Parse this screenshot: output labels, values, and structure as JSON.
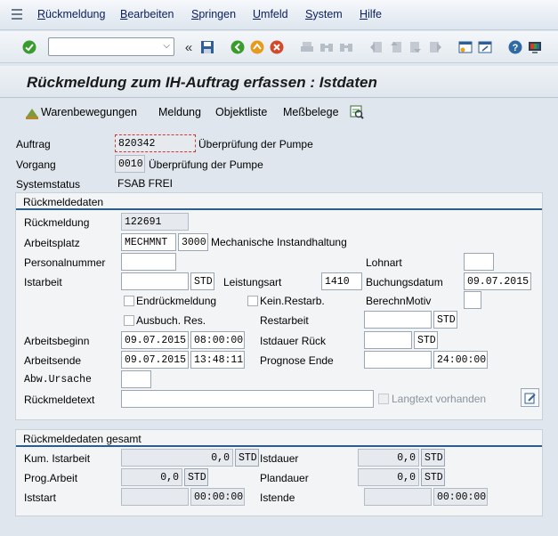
{
  "menu": {
    "items": [
      "Rückmeldung",
      "Bearbeiten",
      "Springen",
      "Umfeld",
      "System",
      "Hilfe"
    ]
  },
  "toolbar": {
    "command_value": "",
    "icons": [
      "enter-icon",
      "back-arrows-icon",
      "save-icon",
      "back-icon",
      "exit-icon",
      "cancel-icon",
      "print-icon",
      "find-icon",
      "find-next-icon",
      "first-page-icon",
      "prev-page-icon",
      "next-page-icon",
      "last-page-icon",
      "new-session-icon",
      "shortcut-icon",
      "help-icon",
      "customize-icon"
    ]
  },
  "title": "Rückmeldung zum IH-Auftrag erfassen : Istdaten",
  "app_toolbar": {
    "warenbewegungen": "Warenbewegungen",
    "meldung": "Meldung",
    "objektliste": "Objektliste",
    "messbelege": "Meßbelege"
  },
  "header": {
    "auftrag_label": "Auftrag",
    "auftrag_value": "820342",
    "auftrag_text": "Überprüfung der Pumpe",
    "vorgang_label": "Vorgang",
    "vorgang_value": "0010",
    "vorgang_text": "Überprüfung der Pumpe",
    "systemstatus_label": "Systemstatus",
    "systemstatus_value": "FSAB FREI"
  },
  "rueckmeldedaten": {
    "title": "Rückmeldedaten",
    "rueckmeldung_label": "Rückmeldung",
    "rueckmeldung_value": "122691",
    "arbeitsplatz_label": "Arbeitsplatz",
    "arbeitsplatz_value": "MECHMNT",
    "werk_value": "3000",
    "arbeitsplatz_text": "Mechanische Instandhaltung",
    "personalnummer_label": "Personalnummer",
    "personalnummer_value": "",
    "lohnart_label": "Lohnart",
    "lohnart_value": "",
    "istarbeit_label": "Istarbeit",
    "istarbeit_value": "",
    "istarbeit_unit": "STD",
    "leistungsart_label": "Leistungsart",
    "leistungsart_value": "1410",
    "buchungsdatum_label": "Buchungsdatum",
    "buchungsdatum_value": "09.07.2015",
    "endrueckmeldung_label": "Endrückmeldung",
    "kein_restarb_label": "Kein.Restarb.",
    "berechnmotiv_label": "BerechnMotiv",
    "berechnmotiv_value": "",
    "ausbuch_res_label": "Ausbuch. Res.",
    "restarbeit_label": "Restarbeit",
    "restarbeit_value": "",
    "restarbeit_unit": "STD",
    "arbeitsbeginn_label": "Arbeitsbeginn",
    "arbeitsbeginn_date": "09.07.2015",
    "arbeitsbeginn_time": "08:00:00",
    "istdauer_rueck_label": "Istdauer Rück",
    "istdauer_rueck_value": "",
    "istdauer_rueck_unit": "STD",
    "arbeitsende_label": "Arbeitsende",
    "arbeitsende_date": "09.07.2015",
    "arbeitsende_time": "13:48:11",
    "prognose_ende_label": "Prognose Ende",
    "prognose_ende_date": "",
    "prognose_ende_time": "24:00:00",
    "abw_ursache_label": "Abw.Ursache",
    "abw_ursache_value": "",
    "rueckmeldetext_label": "Rückmeldetext",
    "rueckmeldetext_value": "",
    "langtext_label": "Langtext vorhanden"
  },
  "gesamt": {
    "title": "Rückmeldedaten gesamt",
    "kum_istarbeit_label": "Kum. Istarbeit",
    "kum_istarbeit_value": "0,0",
    "kum_istarbeit_unit": "STD",
    "istdauer_label": "Istdauer",
    "istdauer_value": "0,0",
    "istdauer_unit": "STD",
    "prog_arbeit_label": "Prog.Arbeit",
    "prog_arbeit_value": "0,0",
    "prog_arbeit_unit": "STD",
    "plandauer_label": "Plandauer",
    "plandauer_value": "0,0",
    "plandauer_unit": "STD",
    "iststart_label": "Iststart",
    "iststart_date": "",
    "iststart_time": "00:00:00",
    "istende_label": "Istende",
    "istende_date": "",
    "istende_time": "00:00:00"
  }
}
